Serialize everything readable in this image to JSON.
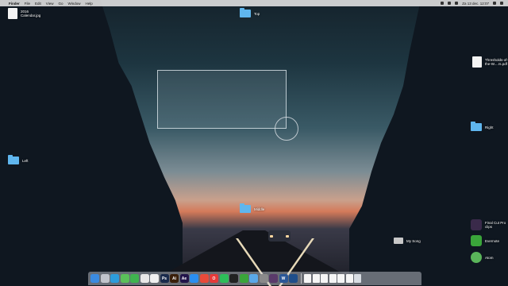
{
  "menubar": {
    "apple_glyph": "",
    "items": [
      "Finder",
      "File",
      "Edit",
      "View",
      "Go",
      "Window",
      "Help"
    ],
    "clock": "Za 13 dec. 12:07"
  },
  "desktop": {
    "items": [
      {
        "label": "2016\nCalendar.jpg",
        "kind": "document"
      },
      {
        "label": "Top",
        "kind": "folder"
      },
      {
        "label": "Thresholds-of-\nthe-W....rs.pdf",
        "kind": "document"
      },
      {
        "label": "Right",
        "kind": "folder"
      },
      {
        "label": "Left",
        "kind": "folder"
      },
      {
        "label": "Middle",
        "kind": "folder"
      },
      {
        "label": "My Song",
        "kind": "audio"
      },
      {
        "label": "Final Cut Pro\nclips",
        "kind": "app"
      },
      {
        "label": "Evernote",
        "kind": "app"
      },
      {
        "label": "Atom",
        "kind": "app"
      }
    ]
  },
  "colors": {
    "folder": "#5fb6ee",
    "menubar_bg": "#ebebeb",
    "selection_border": "#dce6eb"
  },
  "dock": {
    "apps": [
      {
        "name": "finder-icon",
        "color": "#3b8be0",
        "glyph": ""
      },
      {
        "name": "launchpad-icon",
        "color": "#c0c4cc",
        "glyph": ""
      },
      {
        "name": "safari-icon",
        "color": "#2d9cdb",
        "glyph": ""
      },
      {
        "name": "messages-icon",
        "color": "#5ac05a",
        "glyph": ""
      },
      {
        "name": "facetime-icon",
        "color": "#3fb34f",
        "glyph": ""
      },
      {
        "name": "photos-icon",
        "color": "#e8e8e8",
        "glyph": ""
      },
      {
        "name": "calendar-icon",
        "color": "#f0f0f0",
        "glyph": ""
      },
      {
        "name": "photoshop-icon",
        "color": "#1a2b4c",
        "glyph": "Ps"
      },
      {
        "name": "illustrator-icon",
        "color": "#3a1f0a",
        "glyph": "Ai"
      },
      {
        "name": "aftereffects-icon",
        "color": "#22144a",
        "glyph": "Ae"
      },
      {
        "name": "app-store-icon",
        "color": "#2a8ef0",
        "glyph": ""
      },
      {
        "name": "chrome-icon",
        "color": "#e84a3a",
        "glyph": ""
      },
      {
        "name": "opera-icon",
        "color": "#e63a3a",
        "glyph": "O"
      },
      {
        "name": "spotify-icon",
        "color": "#2ebd59",
        "glyph": ""
      },
      {
        "name": "terminal-icon",
        "color": "#222222",
        "glyph": ""
      },
      {
        "name": "evernote-icon",
        "color": "#3aa53a",
        "glyph": ""
      },
      {
        "name": "mail-icon",
        "color": "#5aa8e8",
        "glyph": ""
      },
      {
        "name": "stack-icon",
        "color": "#8a8a8a",
        "glyph": ""
      },
      {
        "name": "final-cut-icon",
        "color": "#5a3a6a",
        "glyph": ""
      },
      {
        "name": "word-icon",
        "color": "#2b5797",
        "glyph": "W"
      },
      {
        "name": "quicktime-icon",
        "color": "#1f4e8a",
        "glyph": ""
      }
    ],
    "docs": [
      "doc-1",
      "doc-2",
      "doc-3",
      "doc-4",
      "doc-5",
      "doc-6"
    ],
    "trash": "trash-icon"
  }
}
